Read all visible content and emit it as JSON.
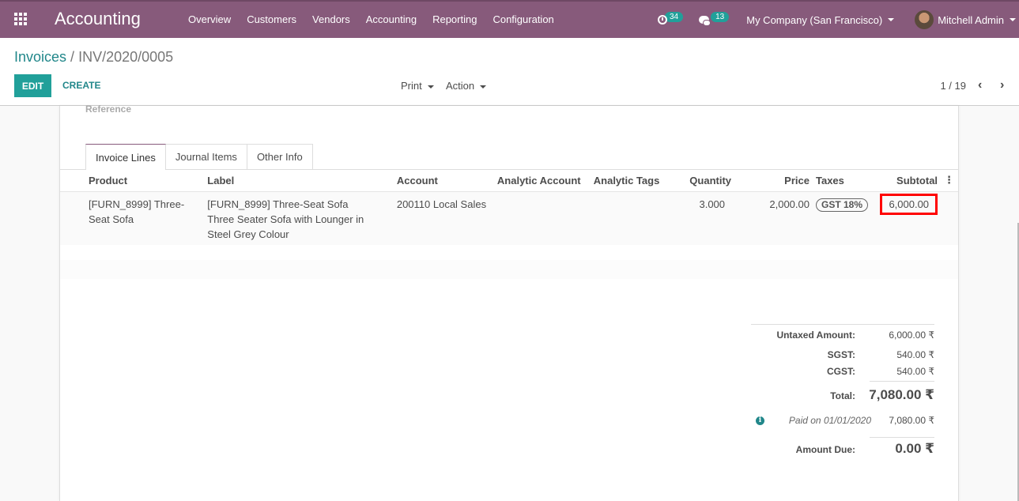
{
  "navbar": {
    "app_name": "Accounting",
    "menu": [
      "Overview",
      "Customers",
      "Vendors",
      "Accounting",
      "Reporting",
      "Configuration"
    ],
    "activity_count": "34",
    "message_count": "13",
    "company": "My Company (San Francisco)",
    "user": "Mitchell Admin"
  },
  "control": {
    "breadcrumb_parent": "Invoices",
    "breadcrumb_sep": "/",
    "breadcrumb_current": "INV/2020/0005",
    "edit_label": "EDIT",
    "create_label": "CREATE",
    "print_label": "Print",
    "action_label": "Action",
    "pager": "1 / 19",
    "prev_icon": "‹",
    "next_icon": "›"
  },
  "form": {
    "reference_label": "Reference",
    "tabs": [
      "Invoice Lines",
      "Journal Items",
      "Other Info"
    ],
    "active_tab": "Invoice Lines",
    "columns": [
      "Product",
      "Label",
      "Account",
      "Analytic Account",
      "Analytic Tags",
      "Quantity",
      "Price",
      "Taxes",
      "Subtotal"
    ],
    "lines": [
      {
        "product": "[FURN_8999] Three-Seat Sofa",
        "label_line1": "[FURN_8999] Three-Seat Sofa",
        "label_line2": "Three Seater Sofa with Lounger in",
        "label_line3": "Steel Grey Colour",
        "account": "200110 Local Sales",
        "analytic_account": "",
        "analytic_tags": "",
        "quantity": "3.000",
        "price": "2,000.00",
        "tax": "GST 18%",
        "subtotal": "6,000.00"
      }
    ]
  },
  "totals": {
    "untaxed_label": "Untaxed Amount:",
    "untaxed_value": "6,000.00 ₹",
    "sgst_label": "SGST:",
    "sgst_value": "540.00 ₹",
    "cgst_label": "CGST:",
    "cgst_value": "540.00 ₹",
    "total_label": "Total:",
    "total_value": "7,080.00 ₹",
    "paid_label": "Paid on 01/01/2020",
    "paid_value": "7,080.00 ₹",
    "due_label": "Amount Due:",
    "due_value": "0.00 ₹"
  },
  "colors": {
    "brand": "#875a7b",
    "accent": "#21a09a",
    "link": "#21878a",
    "highlight": "#ff0000"
  }
}
